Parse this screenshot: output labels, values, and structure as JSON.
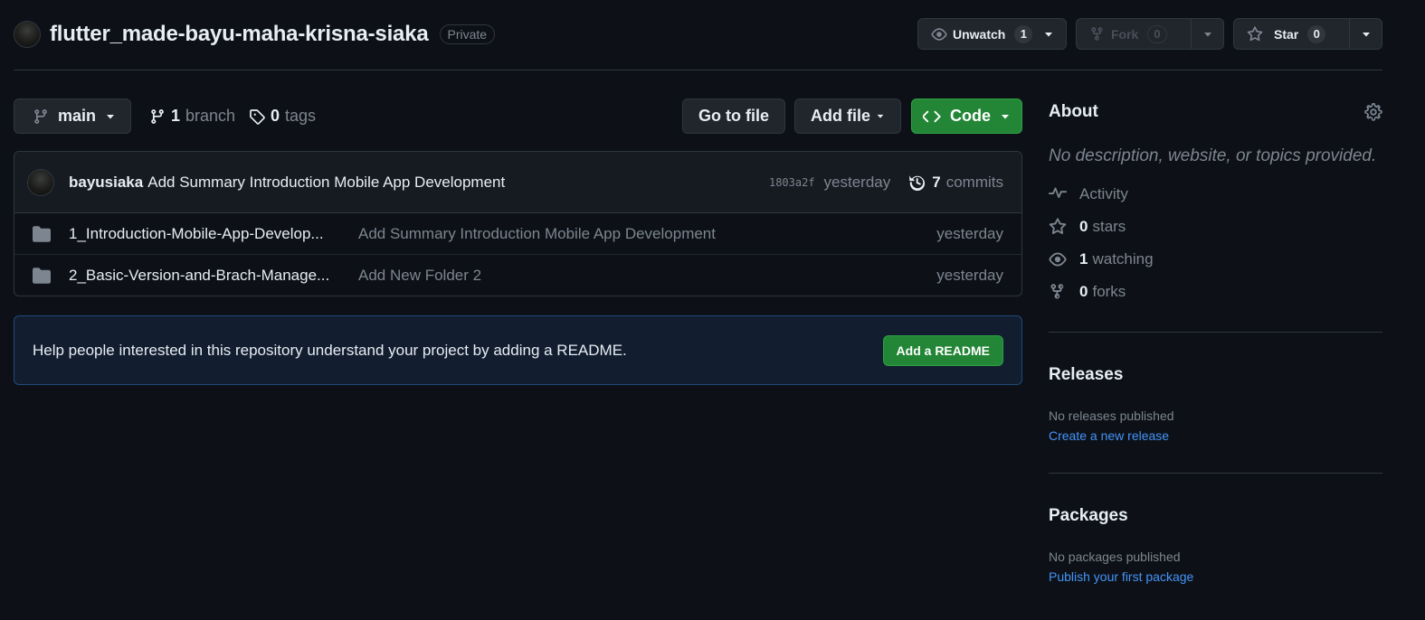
{
  "repo": {
    "name": "flutter_made-bayu-maha-krisna-siaka",
    "visibility": "Private"
  },
  "header_actions": {
    "unwatch": {
      "label": "Unwatch",
      "count": "1"
    },
    "fork": {
      "label": "Fork",
      "count": "0"
    },
    "star": {
      "label": "Star",
      "count": "0"
    }
  },
  "toolbar": {
    "branch_selector": "main",
    "branches_count": "1",
    "branches_label": "branch",
    "tags_count": "0",
    "tags_label": "tags",
    "go_to_file": "Go to file",
    "add_file": "Add file",
    "code": "Code"
  },
  "latest_commit": {
    "author": "bayusiaka",
    "message": "Add Summary Introduction Mobile App Development",
    "sha": "1803a2f",
    "time": "yesterday",
    "commits_count": "7",
    "commits_label": "commits"
  },
  "files": [
    {
      "type": "folder-icon",
      "name": "1_Introduction-Mobile-App-Develop...",
      "message": "Add Summary Introduction Mobile App Development",
      "date": "yesterday"
    },
    {
      "type": "folder-icon",
      "name": "2_Basic-Version-and-Brach-Manage...",
      "message": "Add New Folder 2",
      "date": "yesterday"
    }
  ],
  "readme_prompt": {
    "text": "Help people interested in this repository understand your project by adding a README.",
    "button": "Add a README"
  },
  "sidebar": {
    "about_title": "About",
    "about_description": "No description, website, or topics provided.",
    "stats": {
      "activity": "Activity",
      "stars_count": "0",
      "stars_label": "stars",
      "watching_count": "1",
      "watching_label": "watching",
      "forks_count": "0",
      "forks_label": "forks"
    },
    "releases": {
      "title": "Releases",
      "empty": "No releases published",
      "link": "Create a new release"
    },
    "packages": {
      "title": "Packages",
      "empty": "No packages published",
      "link": "Publish your first package"
    }
  },
  "colors": {
    "background": "#0d1117",
    "border": "#30363d",
    "green": "#238636",
    "link": "#4493f8",
    "muted": "#7d8590"
  }
}
